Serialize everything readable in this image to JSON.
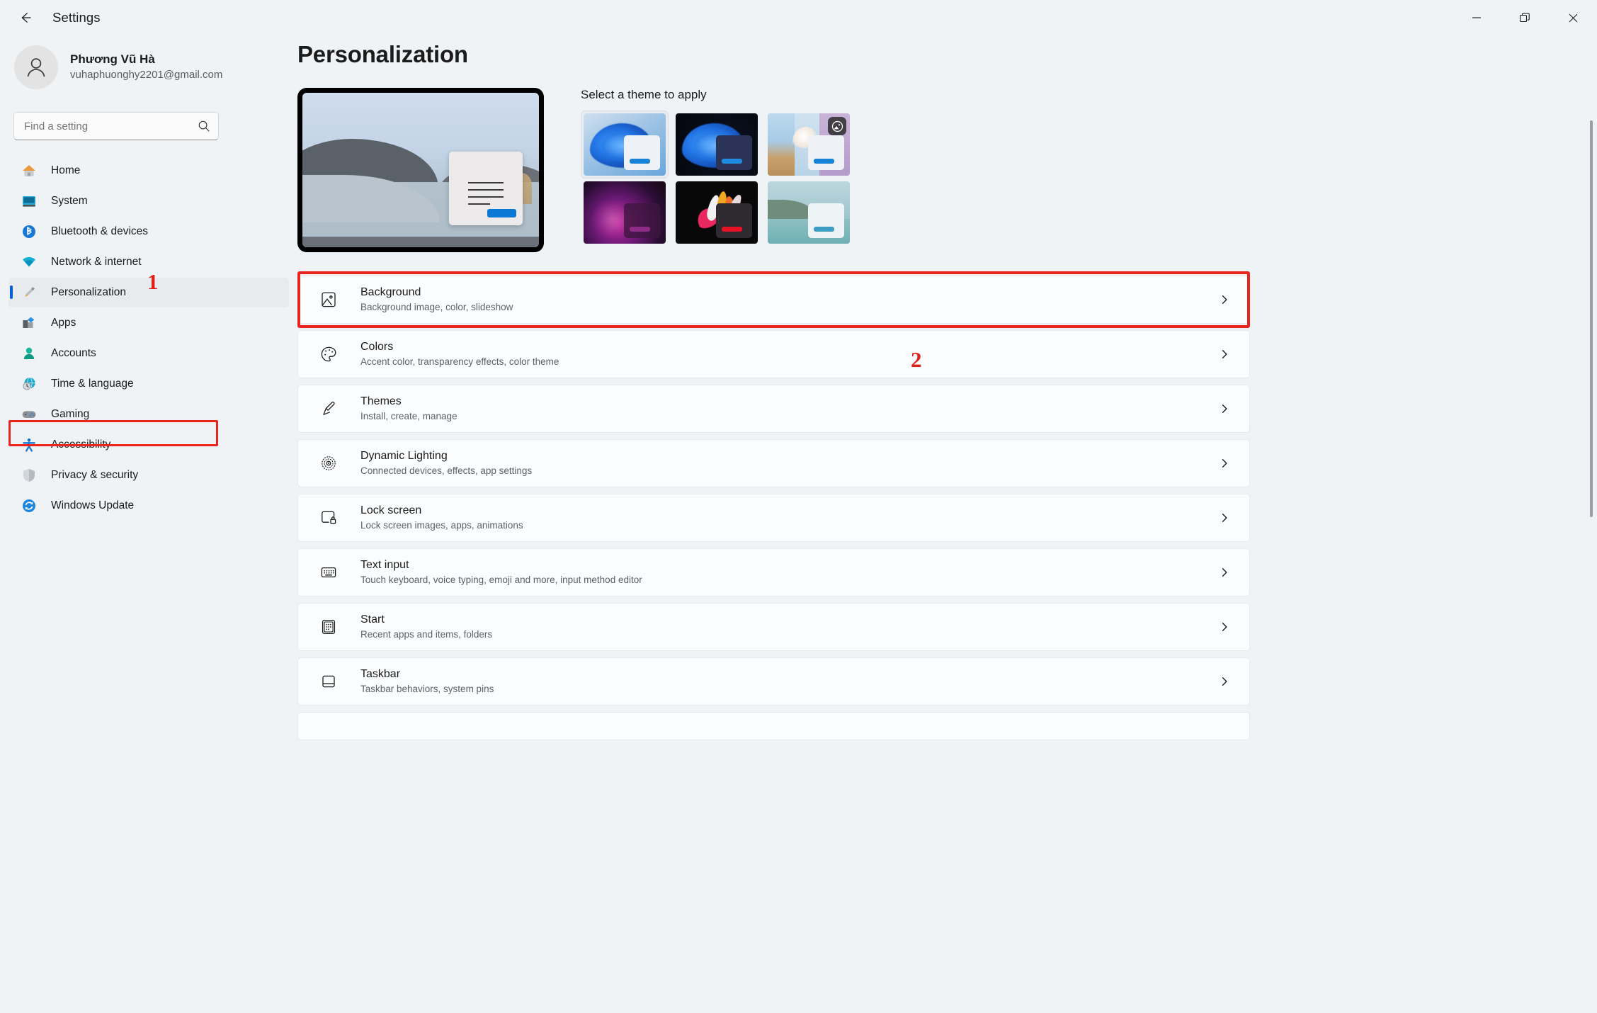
{
  "titlebar": {
    "back_label": "back-arrow",
    "app_title": "Settings",
    "minimize": "minimize",
    "maximize": "restore",
    "close": "close"
  },
  "profile": {
    "name": "Phương Vũ Hà",
    "email": "vuhaphuonghy2201@gmail.com"
  },
  "search": {
    "placeholder": "Find a setting",
    "value": ""
  },
  "sidebar": {
    "items": [
      {
        "label": "Home",
        "icon": "home-icon",
        "active": false
      },
      {
        "label": "System",
        "icon": "system-icon",
        "active": false
      },
      {
        "label": "Bluetooth & devices",
        "icon": "bluetooth-icon",
        "active": false
      },
      {
        "label": "Network & internet",
        "icon": "network-icon",
        "active": false
      },
      {
        "label": "Personalization",
        "icon": "personalization-icon",
        "active": true
      },
      {
        "label": "Apps",
        "icon": "apps-icon",
        "active": false
      },
      {
        "label": "Accounts",
        "icon": "accounts-icon",
        "active": false
      },
      {
        "label": "Time & language",
        "icon": "time-language-icon",
        "active": false
      },
      {
        "label": "Gaming",
        "icon": "gaming-icon",
        "active": false
      },
      {
        "label": "Accessibility",
        "icon": "accessibility-icon",
        "active": false
      },
      {
        "label": "Privacy & security",
        "icon": "privacy-security-icon",
        "active": false
      },
      {
        "label": "Windows Update",
        "icon": "windows-update-icon",
        "active": false
      }
    ]
  },
  "annotations": {
    "marker_1": "1",
    "marker_2": "2",
    "color": "#e8251f"
  },
  "main": {
    "page_title": "Personalization",
    "theme_section_title": "Select a theme to apply",
    "themes": [
      {
        "name": "windows-light-theme",
        "selected": true,
        "badge": false
      },
      {
        "name": "windows-dark-theme",
        "selected": false,
        "badge": false
      },
      {
        "name": "flow-theme",
        "selected": false,
        "badge": true
      },
      {
        "name": "glow-theme",
        "selected": false,
        "badge": false
      },
      {
        "name": "captured-motion-theme",
        "selected": false,
        "badge": false
      },
      {
        "name": "sunrise-theme",
        "selected": false,
        "badge": false
      }
    ],
    "settings": [
      {
        "title": "Background",
        "subtitle": "Background image, color, slideshow",
        "icon": "image-icon",
        "highlighted": true
      },
      {
        "title": "Colors",
        "subtitle": "Accent color, transparency effects, color theme",
        "icon": "palette-icon",
        "highlighted": false
      },
      {
        "title": "Themes",
        "subtitle": "Install, create, manage",
        "icon": "brush-icon",
        "highlighted": false
      },
      {
        "title": "Dynamic Lighting",
        "subtitle": "Connected devices, effects, app settings",
        "icon": "dynamic-lighting-icon",
        "highlighted": false
      },
      {
        "title": "Lock screen",
        "subtitle": "Lock screen images, apps, animations",
        "icon": "lock-screen-icon",
        "highlighted": false
      },
      {
        "title": "Text input",
        "subtitle": "Touch keyboard, voice typing, emoji and more, input method editor",
        "icon": "keyboard-icon",
        "highlighted": false
      },
      {
        "title": "Start",
        "subtitle": "Recent apps and items, folders",
        "icon": "start-icon",
        "highlighted": false
      },
      {
        "title": "Taskbar",
        "subtitle": "Taskbar behaviors, system pins",
        "icon": "taskbar-icon",
        "highlighted": false
      }
    ]
  }
}
